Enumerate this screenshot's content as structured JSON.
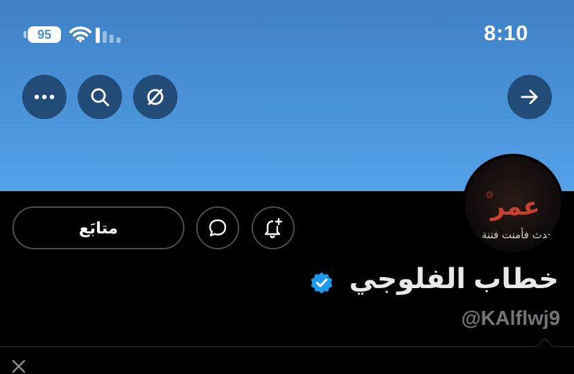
{
  "status_bar": {
    "battery_level": "95",
    "time": "8:10"
  },
  "header": {
    "more_icon": "more-horizontal-icon",
    "search_icon": "search-icon",
    "no_translate_icon": "circle-slash-icon",
    "back_icon": "arrow-right-icon"
  },
  "profile": {
    "follow_label": "متابَع",
    "display_name": "خطاب الفلوجي",
    "handle": "@KAlflwj9",
    "verified": true,
    "avatar_text_large": "عمر",
    "avatar_text_small": "حدث فأمنت فتنة"
  },
  "colors": {
    "banner_top": "#3f80c6",
    "banner_bottom": "#54a2ea",
    "verified_blue": "#1d9bf0",
    "handle_gray": "#71767b",
    "avatar_accent": "#b23a2a"
  }
}
